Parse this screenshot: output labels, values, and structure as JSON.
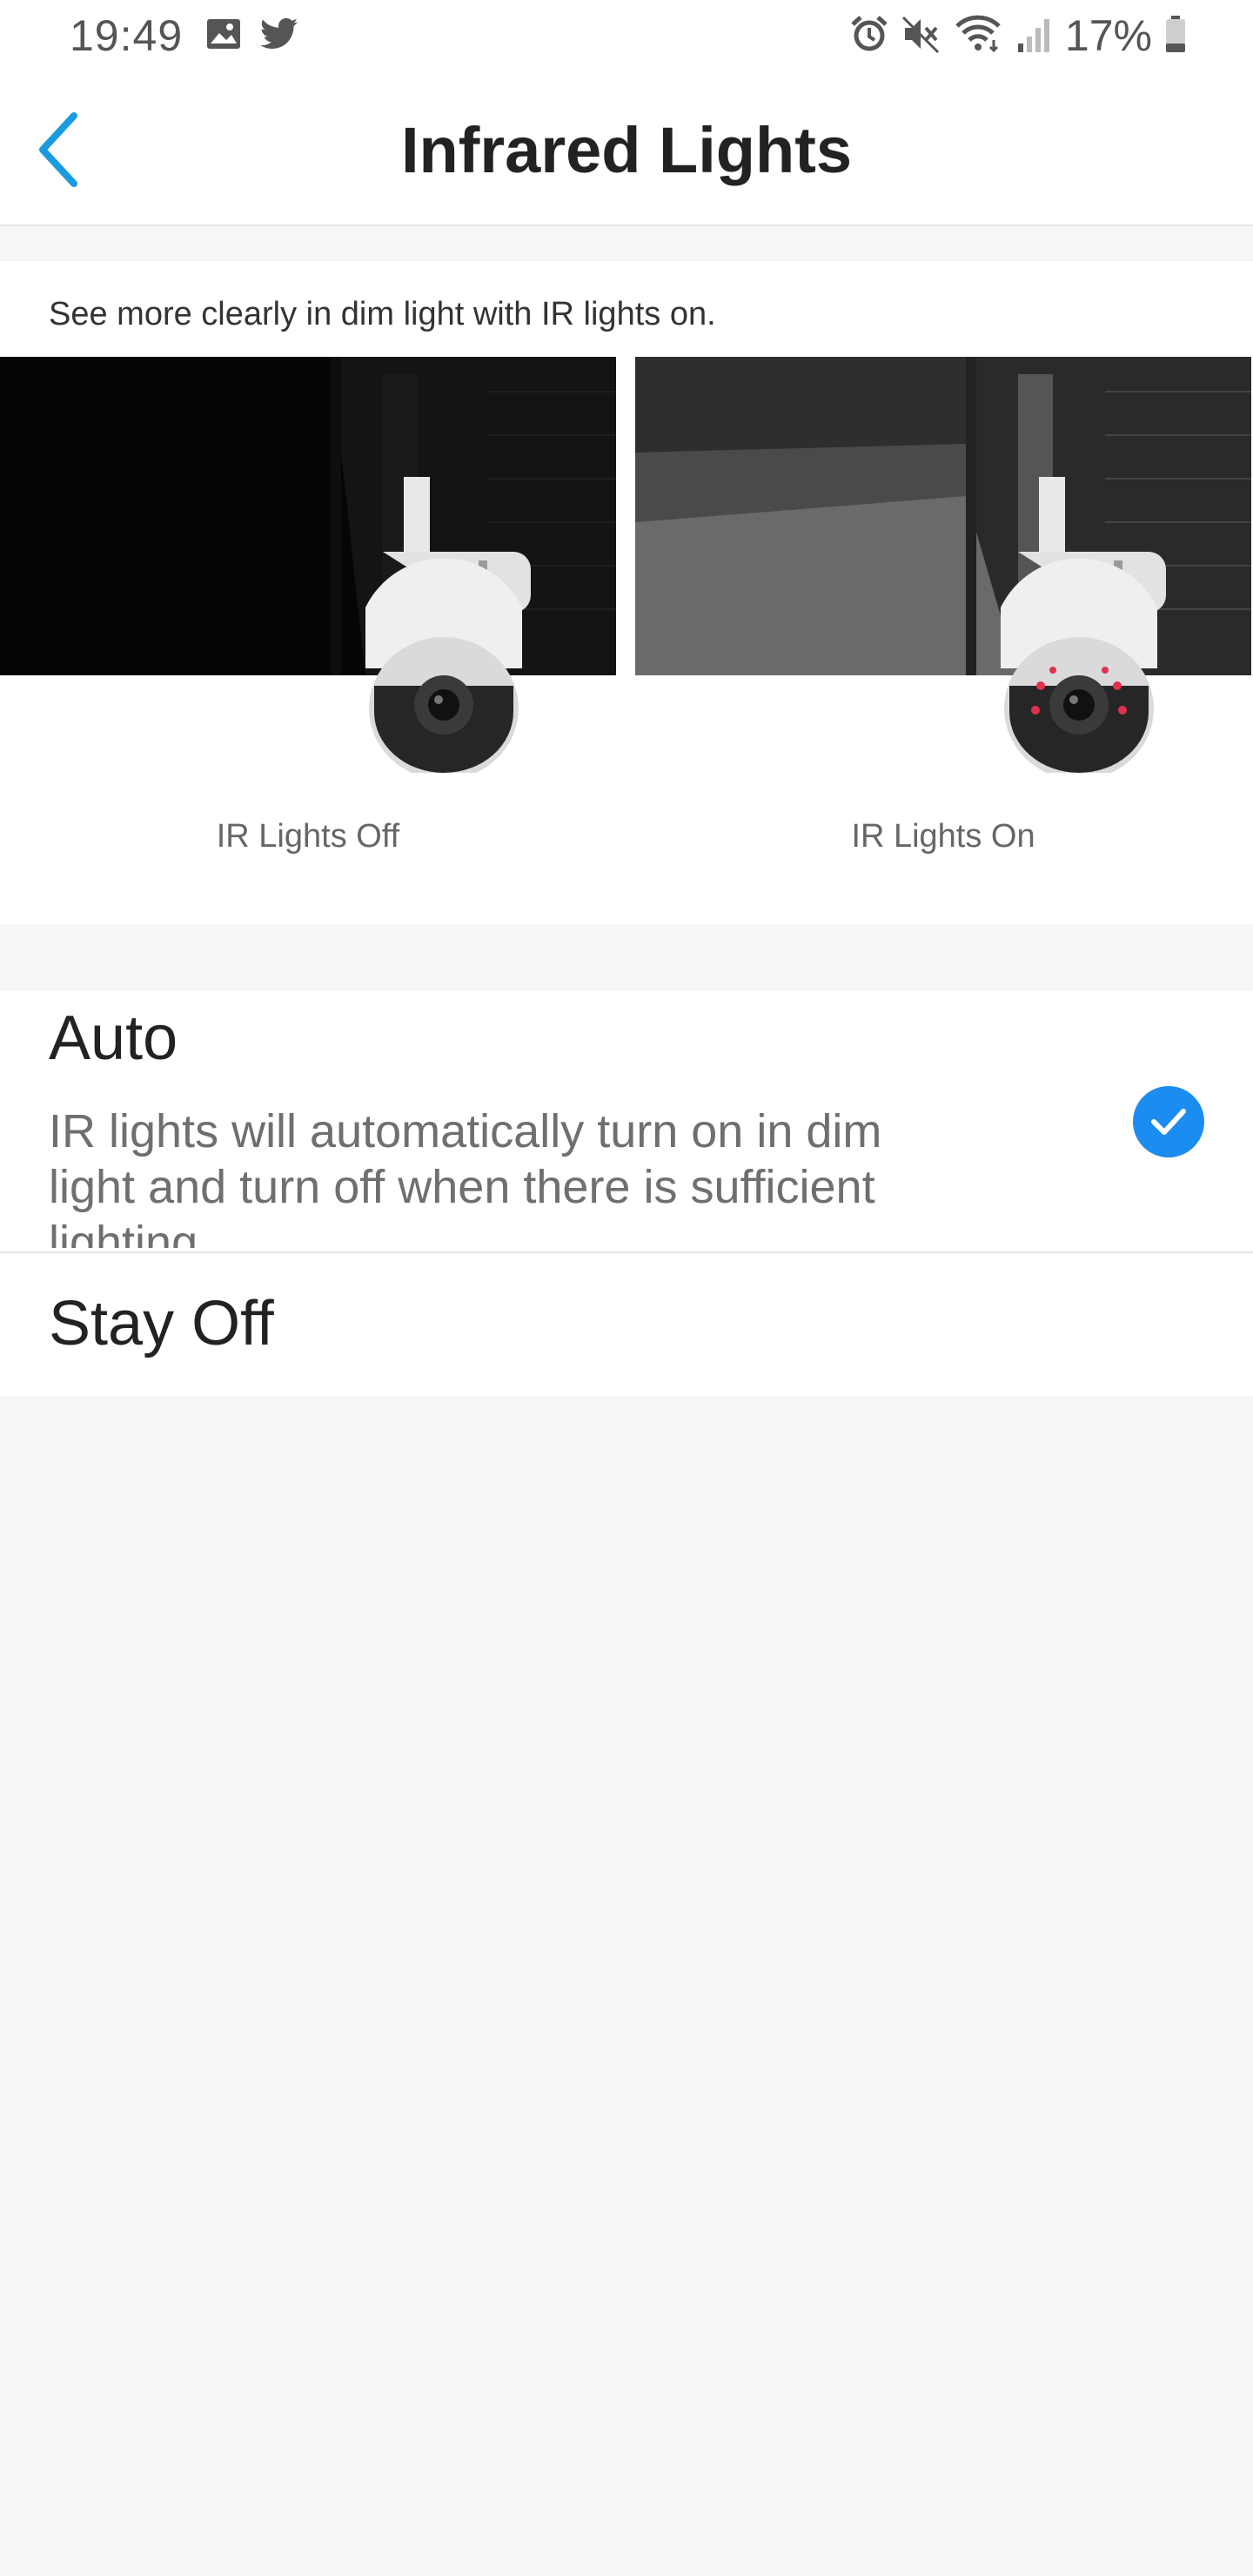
{
  "status_bar": {
    "time": "19:49",
    "battery_percent": "17%",
    "left_icons": [
      "gallery-icon",
      "twitter-icon"
    ],
    "right_icons": [
      "alarm-icon",
      "mute-icon",
      "wifi-icon",
      "signal-icon",
      "battery-icon"
    ]
  },
  "app_bar": {
    "title": "Infrared Lights",
    "back_icon": "chevron-left-icon",
    "accent_color": "#1a9be0"
  },
  "illustration": {
    "description": "See more clearly in dim light with IR lights on.",
    "off_caption": "IR Lights Off",
    "on_caption": "IR Lights On"
  },
  "options": {
    "auto": {
      "title": "Auto",
      "description": "IR lights will automatically turn on in dim light and turn off when there is sufficient lighting",
      "selected": true,
      "check_color": "#1b8cf0"
    },
    "stay_off": {
      "title": "Stay Off",
      "selected": false
    }
  }
}
